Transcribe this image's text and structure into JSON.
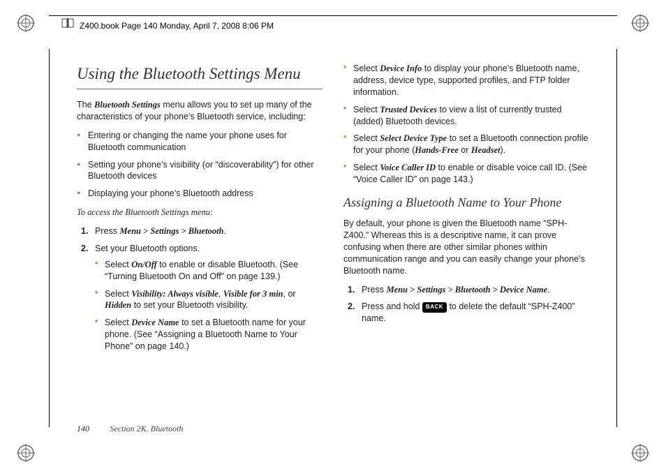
{
  "header": {
    "text": "Z400.book  Page 140  Monday, April 7, 2008  8:06 PM"
  },
  "left": {
    "title": "Using the Bluetooth Settings Menu",
    "intro_pre": "The ",
    "intro_b1": "Bluetooth Settings",
    "intro_post": " menu allows you to set up many of the characteristics of your phone’s Bluetooth service, including:",
    "bullets": [
      "Entering or changing the name your phone uses for Bluetooth communication",
      "Setting your phone’s visibility (or “discoverability”) for other Bluetooth devices",
      "Displaying your phone’s Bluetooth address"
    ],
    "instr": "To access the Bluetooth Settings menu:",
    "step1_pre": "Press ",
    "step1_b": "Menu > Settings > Bluetooth",
    "step1_post": ".",
    "step2": "Set your Bluetooth options.",
    "sub": [
      {
        "pre": "Select ",
        "b": "On/Off",
        "post": " to enable or disable Bluetooth. (See “Turning Bluetooth On and Off” on page 139.)"
      },
      {
        "pre": "Select ",
        "b": "Visibility: Always visible",
        "mid1": ", ",
        "b2": "Visible for 3 min",
        "mid2": ", or ",
        "b3": "Hidden",
        "post": " to set your Bluetooth visibility."
      },
      {
        "pre": "Select ",
        "b": "Device Name",
        "post": " to set a Bluetooth name for your phone. (See “Assigning a Bluetooth Name to Your Phone” on page 140.)"
      }
    ]
  },
  "right": {
    "sub": [
      {
        "pre": "Select ",
        "b": "Device Info",
        "post": " to display your phone’s Bluetooth name, address, device type, supported profiles, and FTP folder information."
      },
      {
        "pre": "Select ",
        "b": "Trusted Devices",
        "post": " to view a list of currently trusted (added) Bluetooth devices."
      },
      {
        "pre": "Select ",
        "b": "Select Device Type",
        "post": " to set a Bluetooth connection profile for your phone (",
        "b2": "Hands-Free",
        "mid": " or ",
        "b3": "Headset",
        "post2": ")."
      },
      {
        "pre": "Select ",
        "b": "Voice Caller ID",
        "post": " to enable or disable voice call ID. (See “Voice Caller ID” on page 143.)"
      }
    ],
    "subhead": "Assigning a Bluetooth Name to Your Phone",
    "para": "By default, your phone is given the Bluetooth name “SPH-Z400.” Whereas this is a descriptive name, it can prove confusing when there are other similar phones within communication range and you can easily change your phone’s Bluetooth name.",
    "step1_pre": "Press ",
    "step1_b": "Menu > Settings > Bluetooth > Device Name",
    "step1_post": ".",
    "step2_pre": "Press and hold ",
    "step2_key": "BACK",
    "step2_post": " to delete the default “SPH-Z400” name."
  },
  "footer": {
    "page": "140",
    "section": "Section 2K. Bluetooth"
  }
}
